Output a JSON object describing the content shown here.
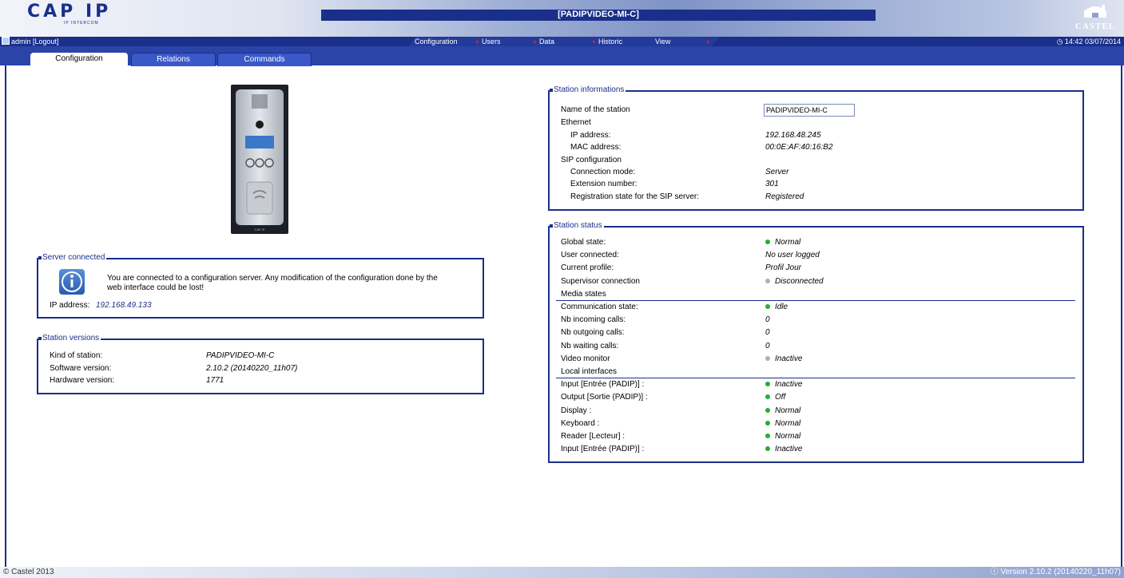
{
  "header": {
    "logo_text": "CAP IP",
    "logo_sub": "IP INTERCOM",
    "station_title": "[PADIPVIDEO-MI-C]",
    "brand": "CASTEL"
  },
  "menubar": {
    "user": "admin [Logout]",
    "items": [
      "Configuration",
      "Users",
      "Data",
      "Historic",
      "View"
    ],
    "datetime": "14:42 03/07/2014"
  },
  "tabs": [
    {
      "label": "Configuration",
      "active": true
    },
    {
      "label": "Relations",
      "active": false
    },
    {
      "label": "Commands",
      "active": false
    }
  ],
  "device_plate": "CAP IP",
  "server_connected": {
    "title": "Server connected",
    "message": "You are connected to a configuration server. Any modification of the configuration done by the",
    "message2": "web interface could be lost!",
    "ip_label": "IP address:",
    "ip_value": "192.168.49.133"
  },
  "station_versions": {
    "title": "Station versions",
    "rows": [
      {
        "label": "Kind of station:",
        "value": "PADIPVIDEO-MI-C"
      },
      {
        "label": "Software version:",
        "value": "2.10.2 (20140220_11h07)"
      },
      {
        "label": "Hardware version:",
        "value": "1771"
      }
    ]
  },
  "station_info": {
    "title": "Station informations",
    "name_label": "Name of the station",
    "name_value": "PADIPVIDEO-MI-C",
    "ethernet": "Ethernet",
    "ip_label": "IP address:",
    "ip_value": "192.168.48.245",
    "mac_label": "MAC address:",
    "mac_value": "00:0E:AF:40:16:B2",
    "sip": "SIP configuration",
    "conn_label": "Connection mode:",
    "conn_value": "Server",
    "ext_label": "Extension number:",
    "ext_value": "301",
    "reg_label": "Registration state for the SIP server:",
    "reg_value": "Registered"
  },
  "station_status": {
    "title": "Station status",
    "general": [
      {
        "label": "Global state:",
        "value": "Normal",
        "dot": "green"
      },
      {
        "label": "User connected:",
        "value": "No user logged",
        "dot": ""
      },
      {
        "label": "Current profile:",
        "value": "Profil Jour",
        "dot": ""
      },
      {
        "label": "Supervisor connection",
        "value": "Disconnected",
        "dot": "grey"
      }
    ],
    "media_title": "Media states",
    "media": [
      {
        "label": "Communication state:",
        "value": "Idle",
        "dot": "green"
      },
      {
        "label": "Nb incoming calls:",
        "value": "0",
        "dot": ""
      },
      {
        "label": "Nb outgoing calls:",
        "value": "0",
        "dot": ""
      },
      {
        "label": "Nb waiting calls:",
        "value": "0",
        "dot": ""
      },
      {
        "label": "Video monitor",
        "value": "Inactive",
        "dot": "grey"
      }
    ],
    "local_title": "Local interfaces",
    "local": [
      {
        "label": "Input [Entrée (PADIP)] :",
        "value": "Inactive",
        "dot": "green"
      },
      {
        "label": "Output [Sortie (PADIP)] :",
        "value": "Off",
        "dot": "green"
      },
      {
        "label": "Display :",
        "value": "Normal",
        "dot": "green"
      },
      {
        "label": "Keyboard :",
        "value": "Normal",
        "dot": "green"
      },
      {
        "label": "Reader [Lecteur] :",
        "value": "Normal",
        "dot": "green"
      },
      {
        "label": "Input [Entrée (PADIP)] :",
        "value": "Inactive",
        "dot": "green"
      }
    ]
  },
  "colors": {
    "green": "#22b030",
    "grey": "#b0b0b0"
  },
  "footer": {
    "copyright": "© Castel 2013",
    "version": "Version 2.10.2 (20140220_11h07)"
  }
}
